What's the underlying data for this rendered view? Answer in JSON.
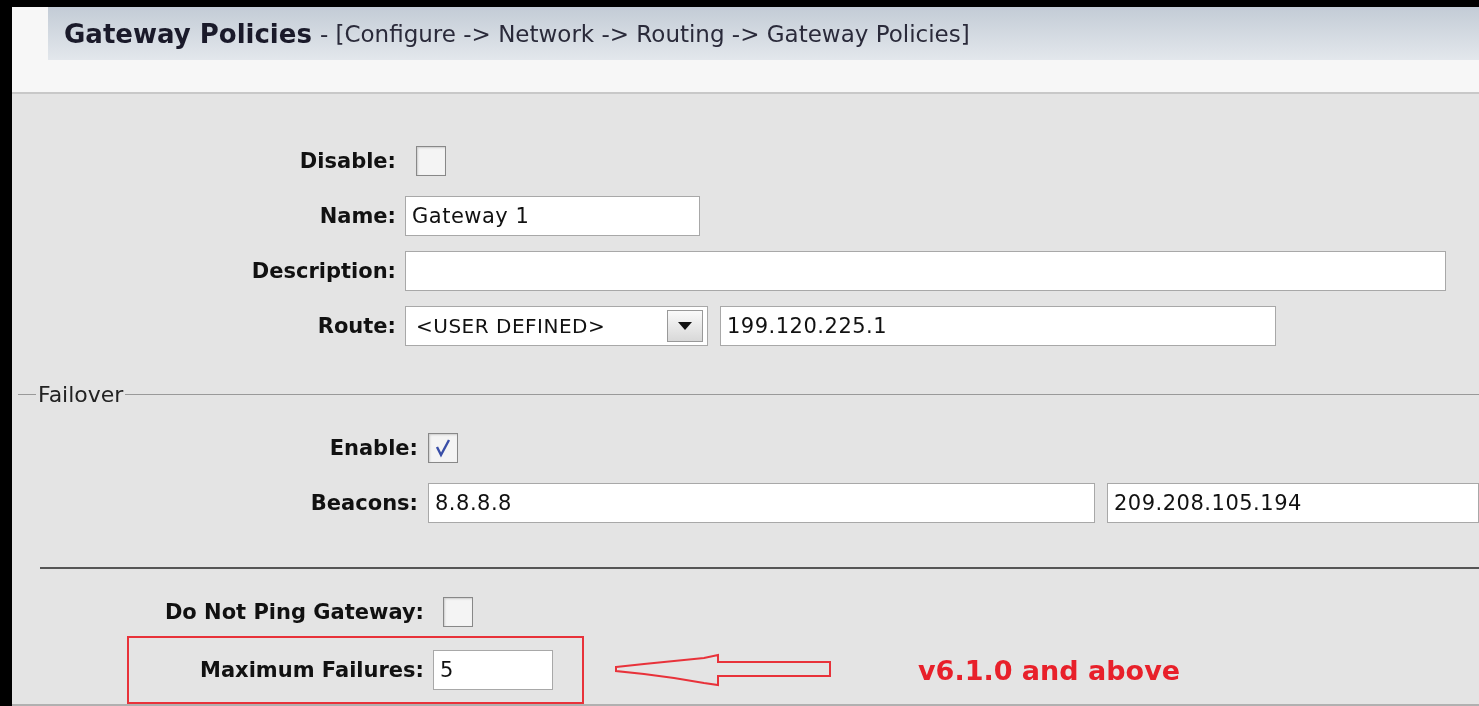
{
  "header": {
    "title": "Gateway Policies",
    "breadcrumb": "- [Configure -> Network -> Routing -> Gateway Policies]"
  },
  "general": [
    {
      "kind": "checkbox",
      "label": "Disable:",
      "checked": false
    },
    {
      "kind": "text",
      "label": "Name:",
      "value": "Gateway 1"
    },
    {
      "kind": "wide",
      "label": "Description:"
    },
    {
      "kind": "route",
      "label": "Route:",
      "select": "<USER DEFINED>",
      "value": "199.120.225.1"
    }
  ],
  "failover": {
    "legend": "Failover",
    "fields": [
      {
        "kind": "checkbox",
        "label": "Enable:",
        "checked": true
      },
      {
        "kind": "pair",
        "label": "Beacons:",
        "values": [
          "8.8.8.8",
          "209.208.105.194"
        ]
      }
    ]
  },
  "extra": [
    {
      "kind": "checkbox",
      "label": "Do Not Ping Gateway:",
      "checked": false,
      "highlighted": false
    },
    {
      "kind": "number",
      "label": "Maximum Failures:",
      "value": "5",
      "highlighted": true
    }
  ],
  "annotation": {
    "text": "v6.1.0 and above"
  }
}
